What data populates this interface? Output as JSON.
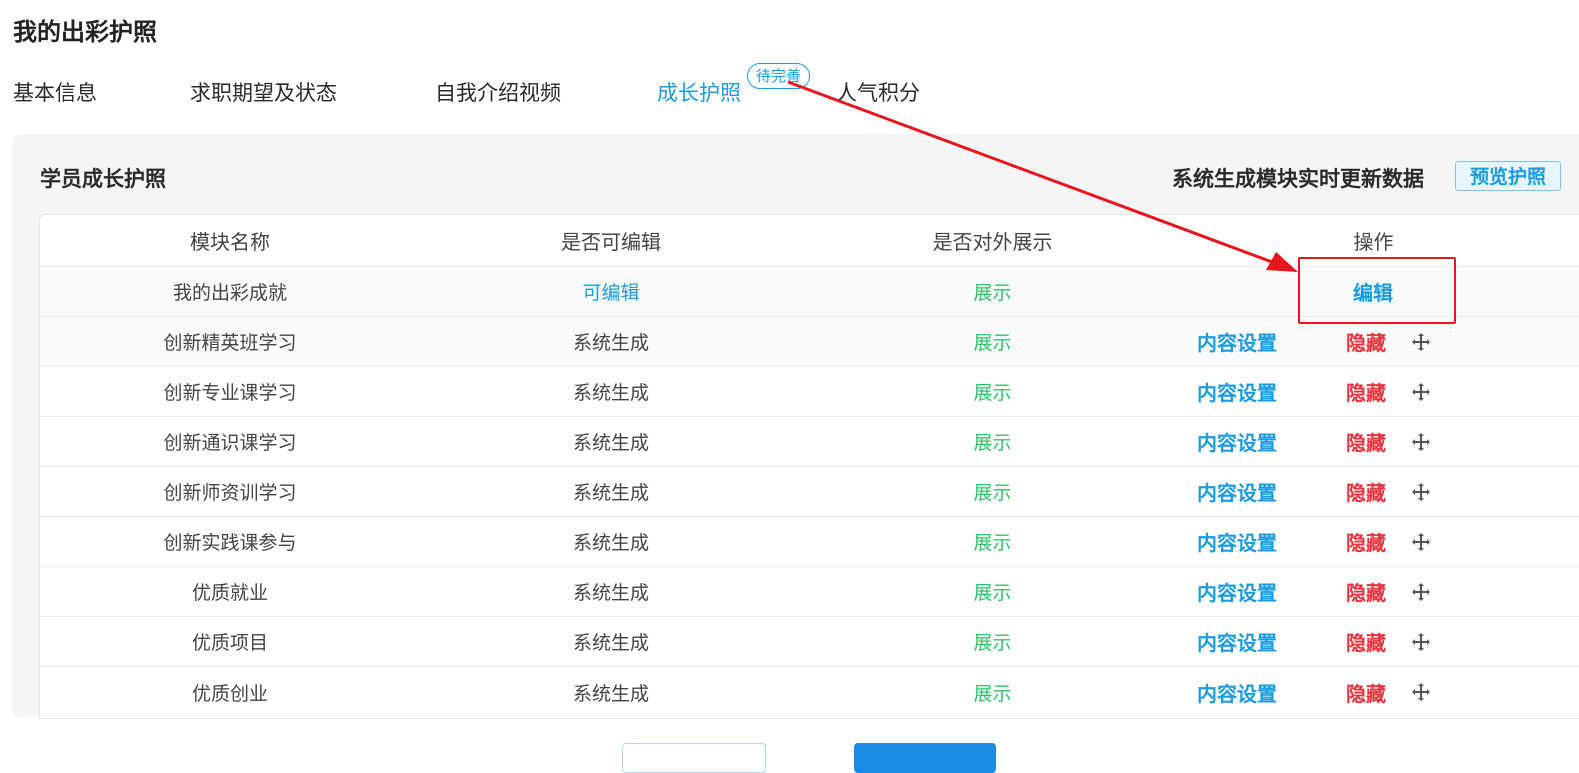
{
  "page_title": "我的出彩护照",
  "tabs": [
    {
      "label": "基本信息",
      "active": false
    },
    {
      "label": "求职期望及状态",
      "active": false
    },
    {
      "label": "自我介绍视频",
      "active": false
    },
    {
      "label": "成长护照",
      "active": true,
      "badge": "待完善"
    },
    {
      "label": "人气积分",
      "active": false
    }
  ],
  "panel": {
    "title": "学员成长护照",
    "note": "系统生成模块实时更新数据",
    "preview_button": "预览护照"
  },
  "table": {
    "headers": [
      "模块名称",
      "是否可编辑",
      "是否对外展示",
      "操作"
    ],
    "rows": [
      {
        "name": "我的出彩成就",
        "editable": "可编辑",
        "display": "展示",
        "actions": [
          "编辑"
        ]
      },
      {
        "name": "创新精英班学习",
        "editable": "系统生成",
        "display": "展示",
        "actions": [
          "内容设置",
          "隐藏"
        ]
      },
      {
        "name": "创新专业课学习",
        "editable": "系统生成",
        "display": "展示",
        "actions": [
          "内容设置",
          "隐藏"
        ]
      },
      {
        "name": "创新通识课学习",
        "editable": "系统生成",
        "display": "展示",
        "actions": [
          "内容设置",
          "隐藏"
        ]
      },
      {
        "name": "创新师资训学习",
        "editable": "系统生成",
        "display": "展示",
        "actions": [
          "内容设置",
          "隐藏"
        ]
      },
      {
        "name": "创新实践课参与",
        "editable": "系统生成",
        "display": "展示",
        "actions": [
          "内容设置",
          "隐藏"
        ]
      },
      {
        "name": "优质就业",
        "editable": "系统生成",
        "display": "展示",
        "actions": [
          "内容设置",
          "隐藏"
        ]
      },
      {
        "name": "优质项目",
        "editable": "系统生成",
        "display": "展示",
        "actions": [
          "内容设置",
          "隐藏"
        ]
      },
      {
        "name": "优质创业",
        "editable": "系统生成",
        "display": "展示",
        "actions": [
          "内容设置",
          "隐藏"
        ]
      }
    ],
    "drag_icon": "move-icon"
  },
  "colors": {
    "accent": "#1a9be0",
    "display_green": "#2ec468",
    "hide_red": "#e8323c",
    "annotation_red": "#e8161c",
    "panel_bg": "#f4f5f7"
  }
}
